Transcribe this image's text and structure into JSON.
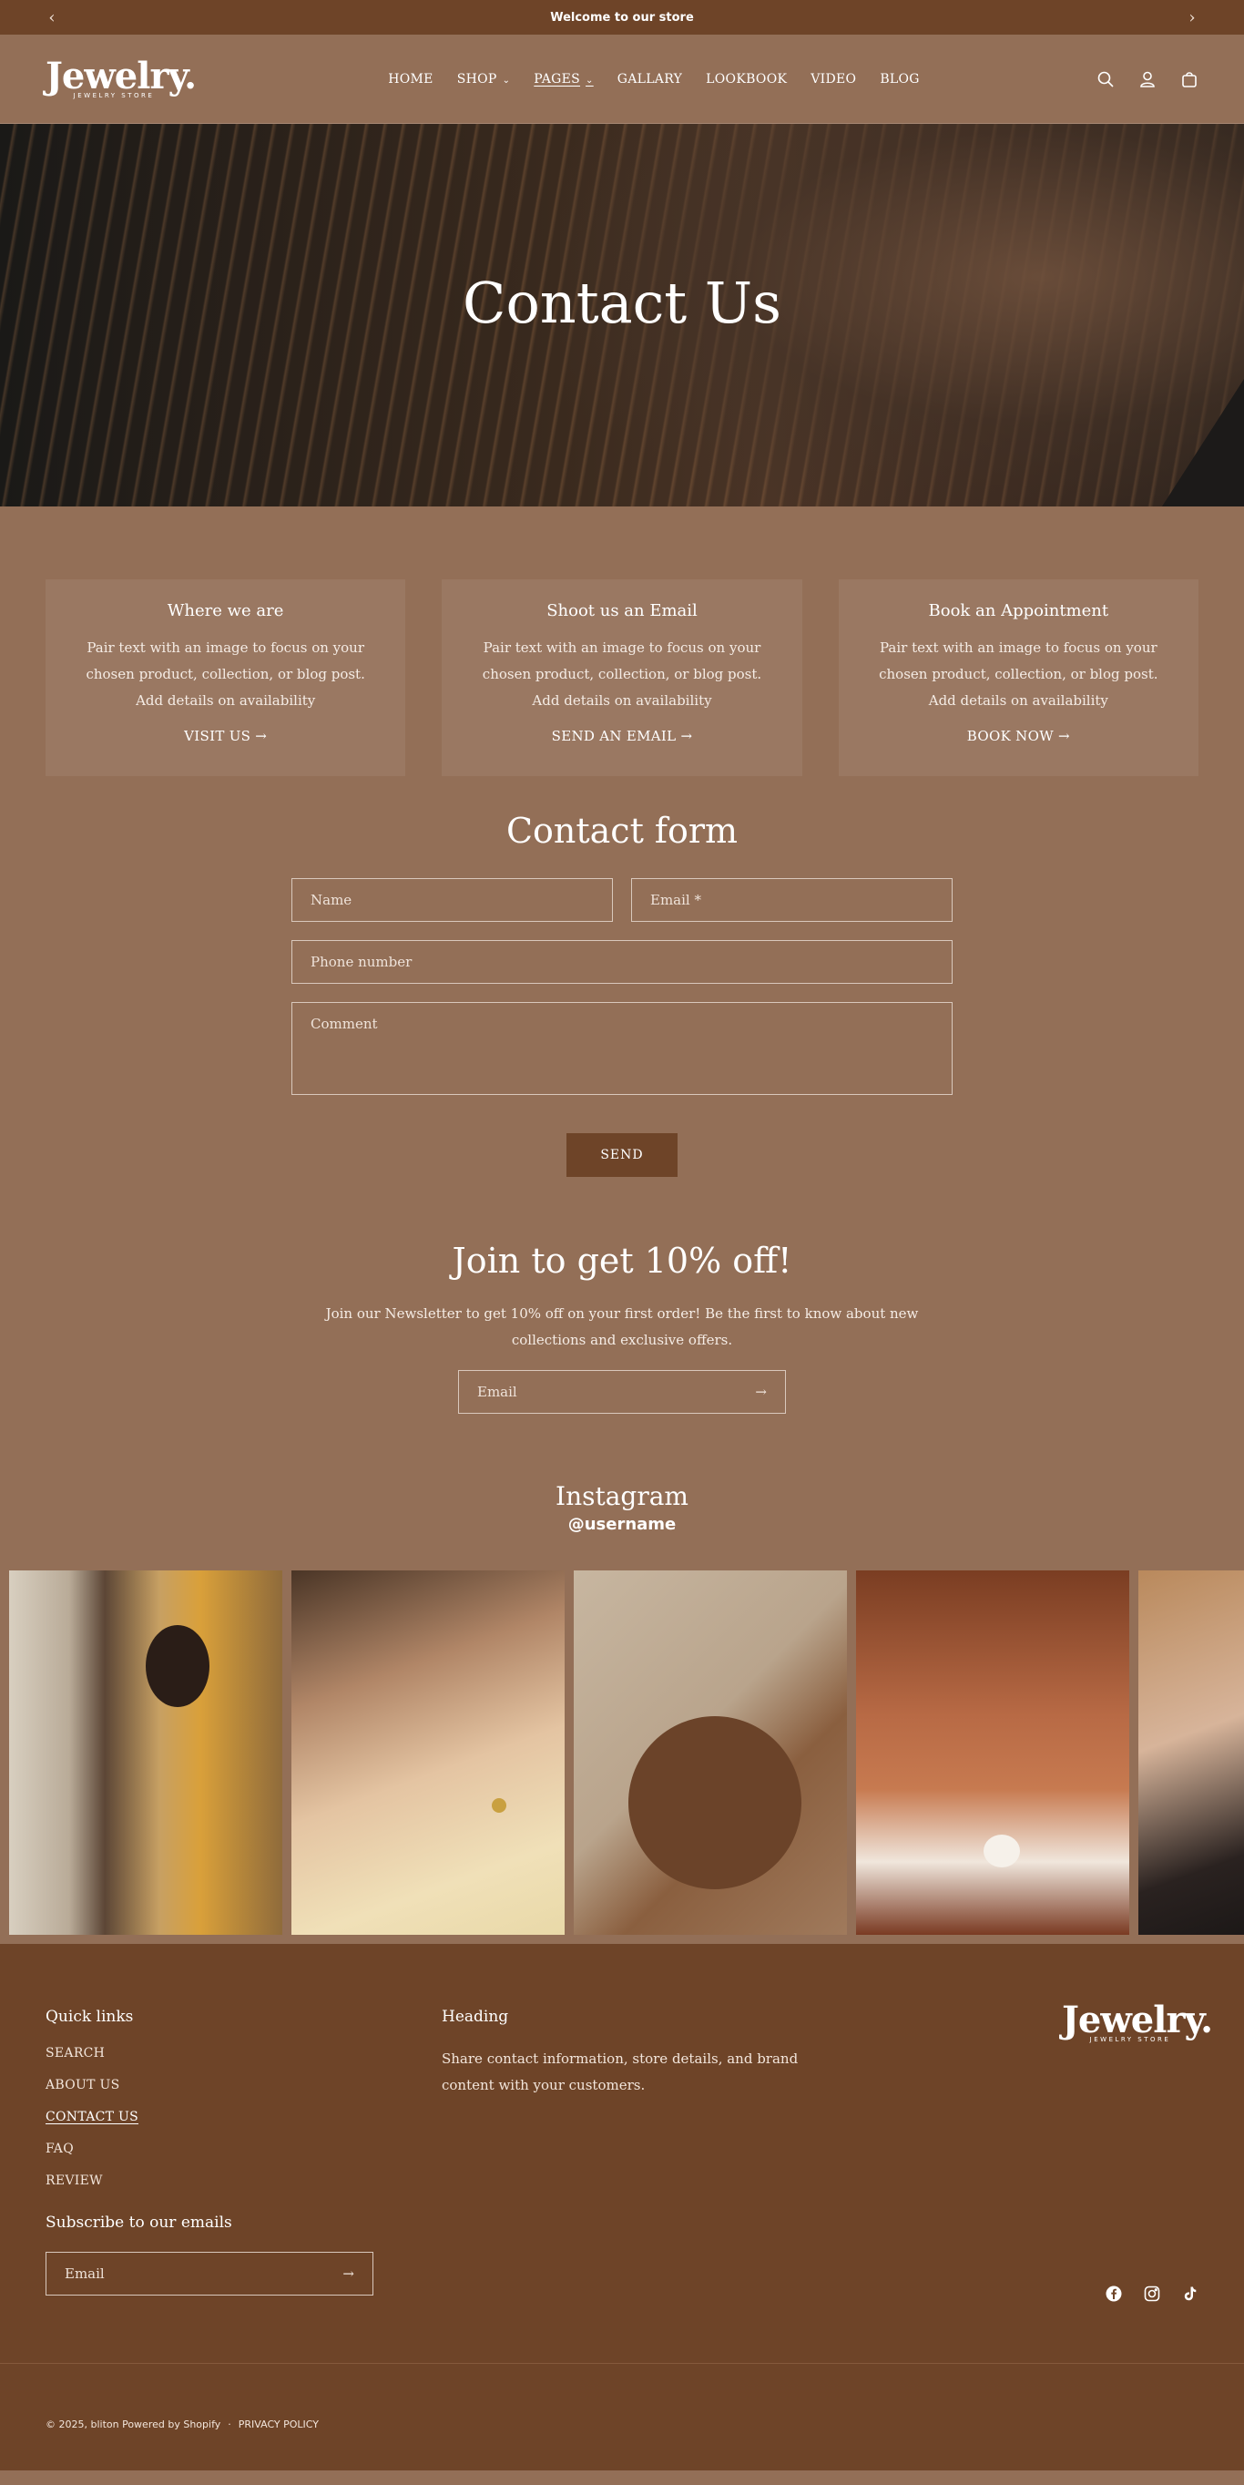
{
  "announcement": {
    "text": "Welcome to our store",
    "prev": "‹",
    "next": "›"
  },
  "brand": {
    "name": "Jewelry.",
    "tagline": "JEWELRY STORE"
  },
  "nav": {
    "items": [
      {
        "label": "HOME"
      },
      {
        "label": "SHOP"
      },
      {
        "label": "PAGES"
      },
      {
        "label": "GALLARY"
      },
      {
        "label": "LOOKBOOK"
      },
      {
        "label": "VIDEO"
      },
      {
        "label": "BLOG"
      }
    ],
    "chevron": "⌄"
  },
  "hero": {
    "title": "Contact Us"
  },
  "cards": [
    {
      "title": "Where we are",
      "text": "Pair text with an image to focus on your chosen product, collection, or blog post. Add details on availability",
      "link": "VISIT US →"
    },
    {
      "title": "Shoot us an Email",
      "text": "Pair text with an image to focus on your chosen product, collection, or blog post. Add details on availability",
      "link": "SEND AN EMAIL →"
    },
    {
      "title": "Book an Appointment",
      "text": "Pair text with an image to focus on your chosen product, collection, or blog post. Add details on availability",
      "link": "BOOK NOW →"
    }
  ],
  "contact_form": {
    "title": "Contact form",
    "name_placeholder": "Name",
    "email_placeholder": "Email *",
    "phone_placeholder": "Phone number",
    "comment_placeholder": "Comment",
    "submit_label": "SEND"
  },
  "newsletter": {
    "title": "Join to get 10% off!",
    "text": "Join our Newsletter to get 10% off on your first order! Be the first to know about new collections and exclusive offers.",
    "email_placeholder": "Email",
    "arrow": "→"
  },
  "instagram": {
    "title": "Instagram",
    "username": "@username"
  },
  "footer": {
    "quick_links_heading": "Quick links",
    "quick_links": [
      "SEARCH",
      "ABOUT US",
      "CONTACT US",
      "FAQ",
      "REVIEW"
    ],
    "info_heading": "Heading",
    "info_text": "Share contact information, store details, and brand content with your customers.",
    "subscribe_heading": "Subscribe to our emails",
    "subscribe_placeholder": "Email",
    "arrow": "→",
    "copyright": "© 2025, bliton Powered by Shopify",
    "separator": "·",
    "privacy": "PRIVACY POLICY"
  }
}
